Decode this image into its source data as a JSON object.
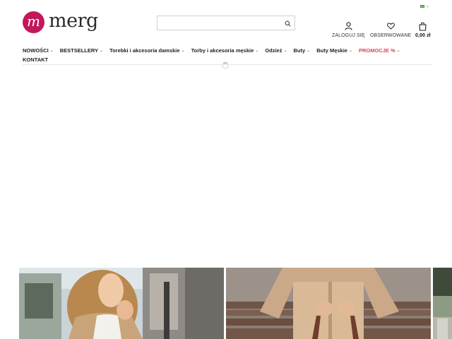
{
  "header": {
    "language": {
      "code": "PL"
    },
    "logo": {
      "text": "merg",
      "mark_letter": "m",
      "brand_color": "#c2185b"
    },
    "search": {
      "value": "",
      "placeholder": ""
    },
    "actions": [
      {
        "label": "ZALOGUJ SIĘ",
        "icon": "user-icon"
      },
      {
        "label": "OBSERWOWANE",
        "icon": "heart-icon"
      },
      {
        "label": "0,00 zł",
        "icon": "bag-icon"
      }
    ]
  },
  "nav": {
    "items": [
      {
        "label": "NOWOŚCI",
        "dropdown": true
      },
      {
        "label": "BESTSELLERY",
        "dropdown": true
      },
      {
        "label": "Torebki i akcesoria damskie",
        "dropdown": true
      },
      {
        "label": "Torby i akcesoria męskie",
        "dropdown": true
      },
      {
        "label": "Odzież",
        "dropdown": true
      },
      {
        "label": "Buty",
        "dropdown": true
      },
      {
        "label": "Buty Męskie",
        "dropdown": true
      },
      {
        "label": "PROMOCJE %",
        "dropdown": true,
        "color": "#e0405e"
      },
      {
        "label": "KONTAKT",
        "dropdown": false
      }
    ],
    "caret": "⌄"
  },
  "gallery": {
    "tiles": [
      {
        "icon": "photo-woman-blonde-beige-coat"
      },
      {
        "icon": "photo-woman-beige-suit-handbag"
      },
      {
        "icon": "photo-outdoor-partial"
      }
    ]
  }
}
